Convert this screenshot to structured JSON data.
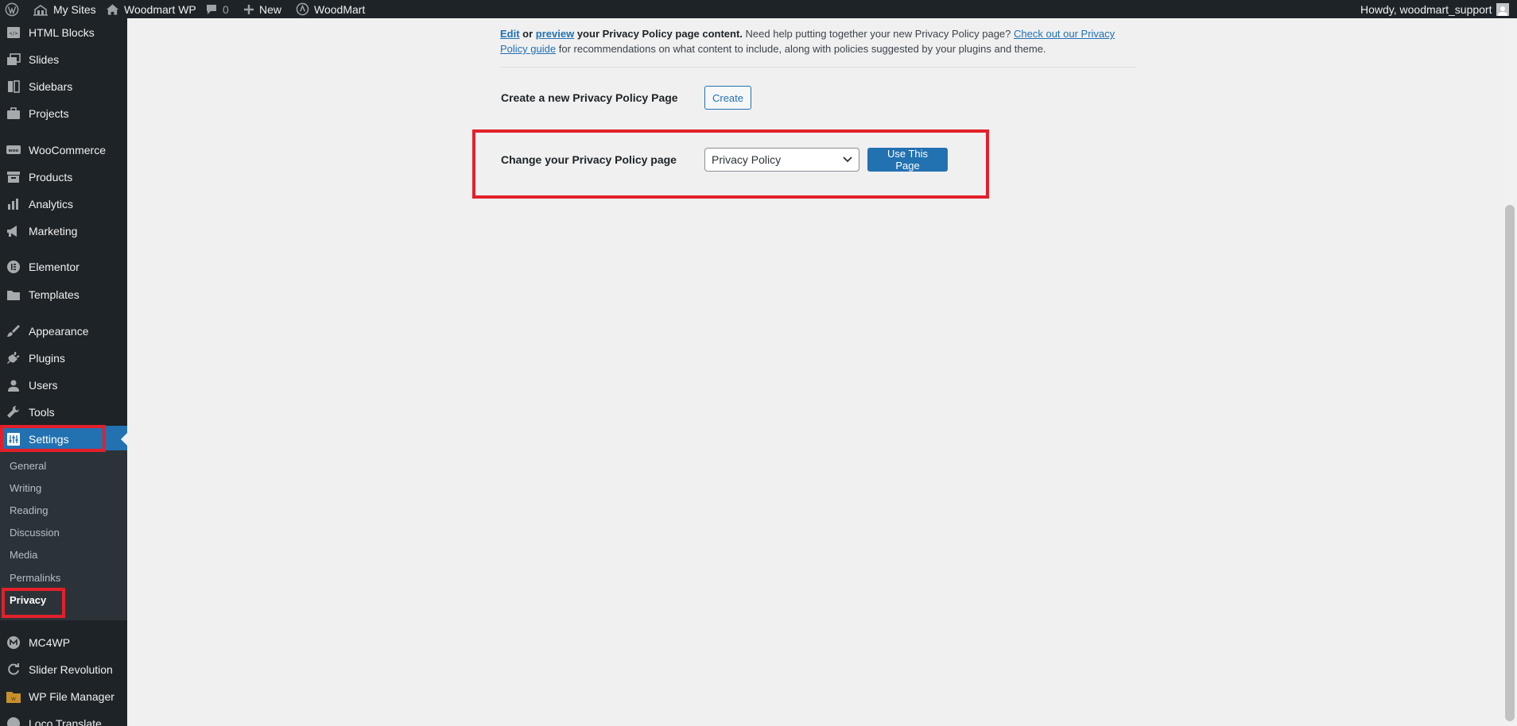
{
  "adminbar": {
    "my_sites": "My Sites",
    "site_name": "Woodmart WP",
    "comments_count": "0",
    "new_label": "New",
    "theme_label": "WoodMart",
    "howdy": "Howdy, woodmart_support"
  },
  "sidebar": {
    "items": [
      {
        "label": "HTML Blocks",
        "icon": "html-blocks-icon"
      },
      {
        "label": "Slides",
        "icon": "slides-icon"
      },
      {
        "label": "Sidebars",
        "icon": "sidebars-icon"
      },
      {
        "label": "Projects",
        "icon": "projects-icon"
      },
      {
        "label": "WooCommerce",
        "icon": "woocommerce-icon"
      },
      {
        "label": "Products",
        "icon": "products-icon"
      },
      {
        "label": "Analytics",
        "icon": "analytics-icon"
      },
      {
        "label": "Marketing",
        "icon": "marketing-icon"
      },
      {
        "label": "Elementor",
        "icon": "elementor-icon"
      },
      {
        "label": "Templates",
        "icon": "templates-icon"
      },
      {
        "label": "Appearance",
        "icon": "appearance-icon"
      },
      {
        "label": "Plugins",
        "icon": "plugins-icon"
      },
      {
        "label": "Users",
        "icon": "users-icon"
      },
      {
        "label": "Tools",
        "icon": "tools-icon"
      },
      {
        "label": "Settings",
        "icon": "settings-icon"
      },
      {
        "label": "MC4WP",
        "icon": "mc4wp-icon"
      },
      {
        "label": "Slider Revolution",
        "icon": "slider-revolution-icon"
      },
      {
        "label": "WP File Manager",
        "icon": "file-manager-icon"
      },
      {
        "label": "Loco Translate",
        "icon": "loco-translate-icon"
      }
    ],
    "settings_submenu": [
      "General",
      "Writing",
      "Reading",
      "Discussion",
      "Media",
      "Permalinks",
      "Privacy"
    ]
  },
  "main": {
    "intro": {
      "edit_link": "Edit",
      "or": " or ",
      "preview_link": "preview",
      "bold_rest": " your Privacy Policy page content.",
      "help_text": " Need help putting together your new Privacy Policy page? ",
      "guide_link": "Check out our Privacy Policy guide",
      "guide_rest": " for recommendations on what content to include, along with policies suggested by your plugins and theme."
    },
    "create_label": "Create a new Privacy Policy Page",
    "create_button": "Create",
    "change_label": "Change your Privacy Policy page",
    "select_value": "Privacy Policy",
    "use_button": "Use This Page"
  },
  "colors": {
    "accent": "#2271b1",
    "highlight": "#e3202a",
    "sidebar_bg": "#1d2327"
  }
}
